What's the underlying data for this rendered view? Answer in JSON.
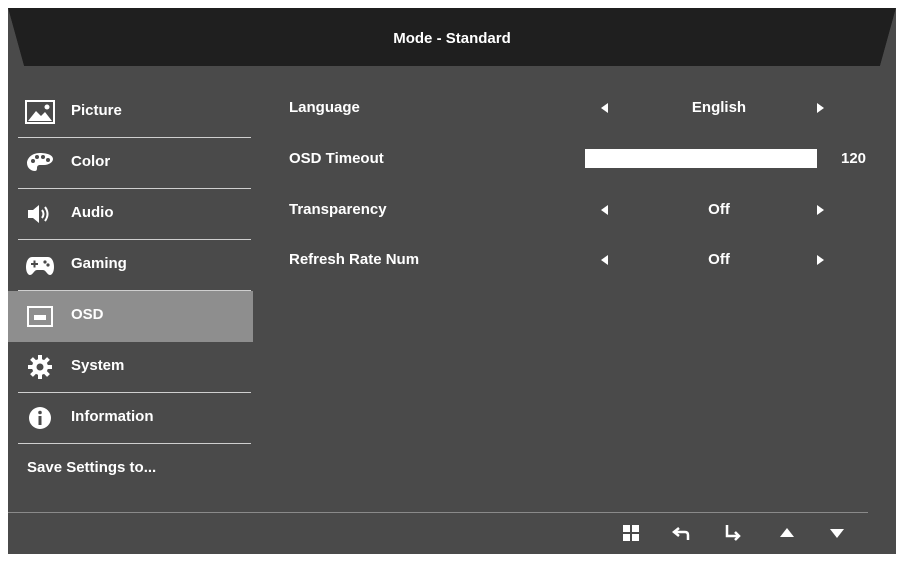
{
  "header": {
    "title": "Mode - Standard"
  },
  "sidebar": {
    "items": [
      {
        "label": "Picture",
        "icon": "picture-icon",
        "active": false
      },
      {
        "label": "Color",
        "icon": "palette-icon",
        "active": false
      },
      {
        "label": "Audio",
        "icon": "speaker-icon",
        "active": false
      },
      {
        "label": "Gaming",
        "icon": "gamepad-icon",
        "active": false
      },
      {
        "label": "OSD",
        "icon": "osd-icon",
        "active": true
      },
      {
        "label": "System",
        "icon": "gear-icon",
        "active": false
      },
      {
        "label": "Information",
        "icon": "info-icon",
        "active": false
      },
      {
        "label": "Save Settings to..."
      }
    ]
  },
  "settings": {
    "language": {
      "label": "Language",
      "value": "English"
    },
    "osd_timeout": {
      "label": "OSD Timeout",
      "value": "120",
      "level": 1.0
    },
    "transparency": {
      "label": "Transparency",
      "value": "Off"
    },
    "refresh_rate_num": {
      "label": "Refresh Rate Num",
      "value": "Off"
    }
  },
  "footer": {
    "icons": [
      "menu-grid-icon",
      "back-icon",
      "enter-icon",
      "up-arrow-icon",
      "down-arrow-icon"
    ]
  },
  "colors": {
    "background": "#4a4a4a",
    "header": "#1f1f1f",
    "active_item": "#8e8e8e",
    "text": "#ffffff"
  }
}
